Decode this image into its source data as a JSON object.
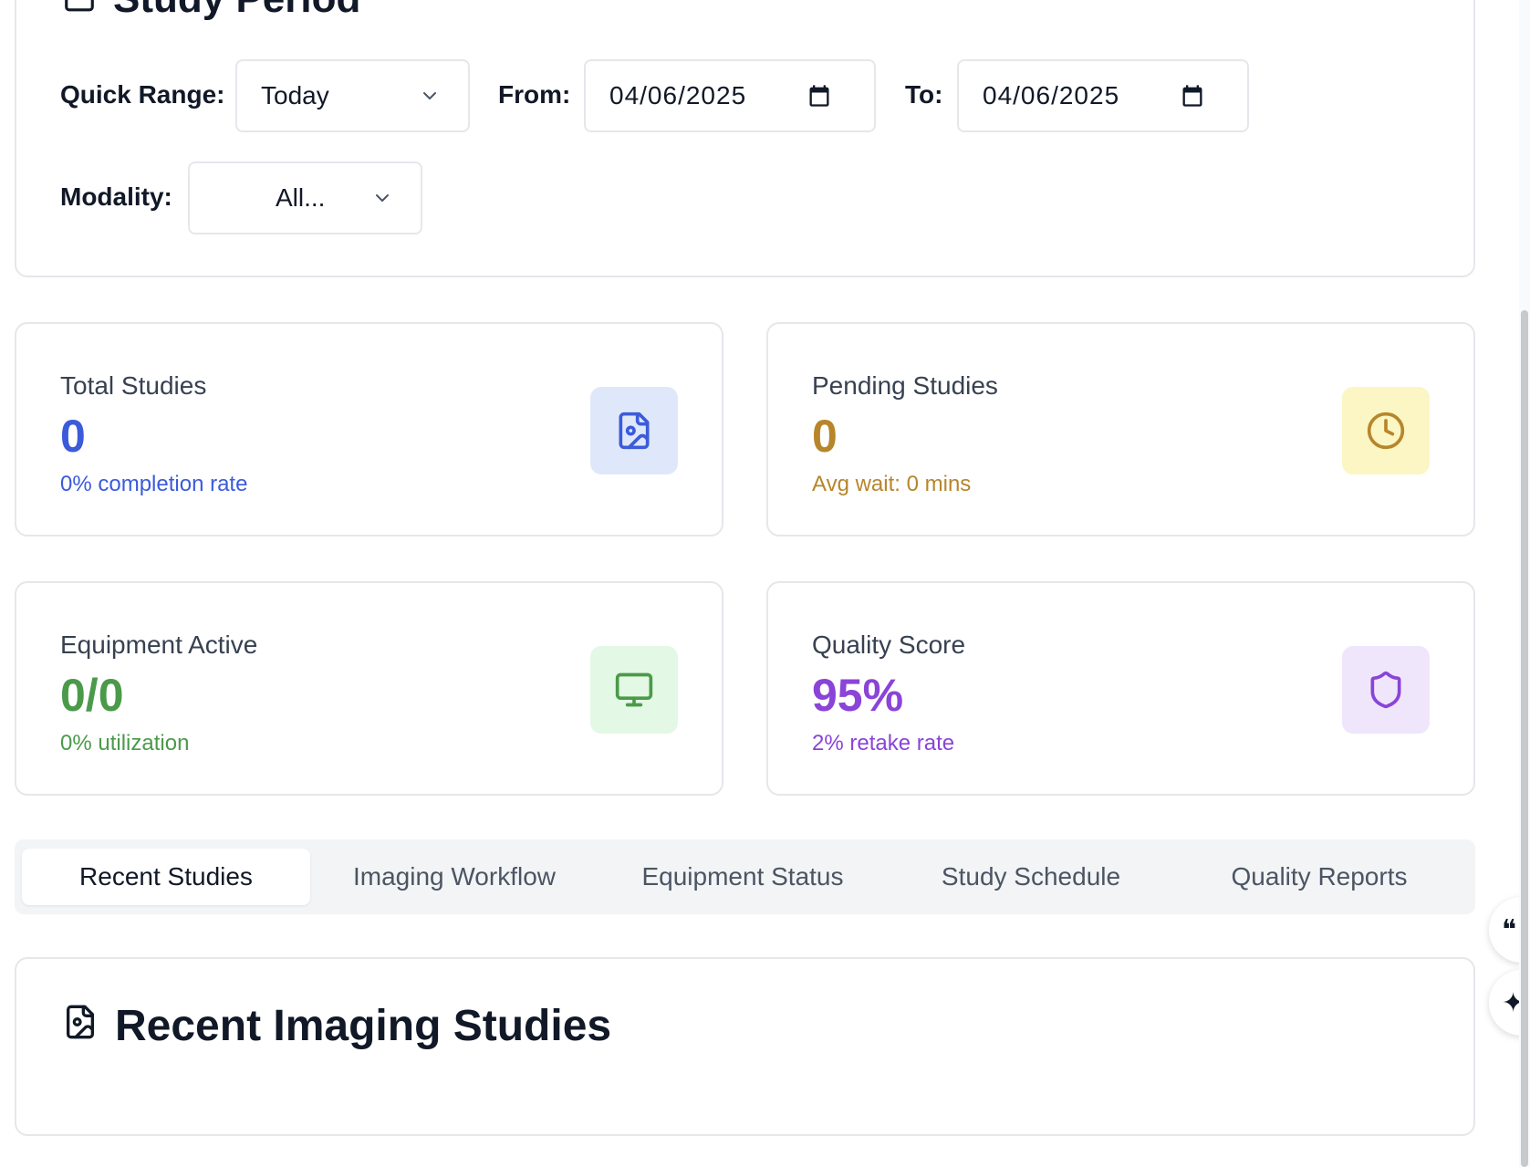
{
  "study_period": {
    "title": "Study Period",
    "quick_range": {
      "label": "Quick Range:",
      "value": "Today"
    },
    "from": {
      "label": "From:",
      "value": "04/06/2025"
    },
    "to": {
      "label": "To:",
      "value": "04/06/2025"
    },
    "modality": {
      "label": "Modality:",
      "value": "All..."
    }
  },
  "stats": {
    "total_studies": {
      "label": "Total Studies",
      "value": "0",
      "sub": "0% completion rate",
      "color": "#3b5bdb",
      "icon_bg": "#dfe8fb",
      "icon": "file-image-icon"
    },
    "pending_studies": {
      "label": "Pending Studies",
      "value": "0",
      "sub": "Avg wait: 0 mins",
      "color": "#b7862b",
      "icon_bg": "#fbf6c3",
      "icon": "clock-icon"
    },
    "equipment_active": {
      "label": "Equipment Active",
      "value": "0/0",
      "sub": "0% utilization",
      "color": "#4a9a4a",
      "icon_bg": "#e3f8e5",
      "icon": "monitor-icon"
    },
    "quality_score": {
      "label": "Quality Score",
      "value": "95%",
      "sub": "2% retake rate",
      "color": "#8a44d8",
      "icon_bg": "#efe6fc",
      "icon": "shield-icon"
    }
  },
  "tabs": [
    {
      "label": "Recent Studies",
      "active": true
    },
    {
      "label": "Imaging Workflow",
      "active": false
    },
    {
      "label": "Equipment Status",
      "active": false
    },
    {
      "label": "Study Schedule",
      "active": false
    },
    {
      "label": "Quality Reports",
      "active": false
    }
  ],
  "recent": {
    "title": "Recent Imaging Studies"
  },
  "side_buttons": [
    {
      "icon": "quote-icon",
      "glyph": "❝"
    },
    {
      "icon": "sparkle-icon",
      "glyph": "✦"
    }
  ]
}
